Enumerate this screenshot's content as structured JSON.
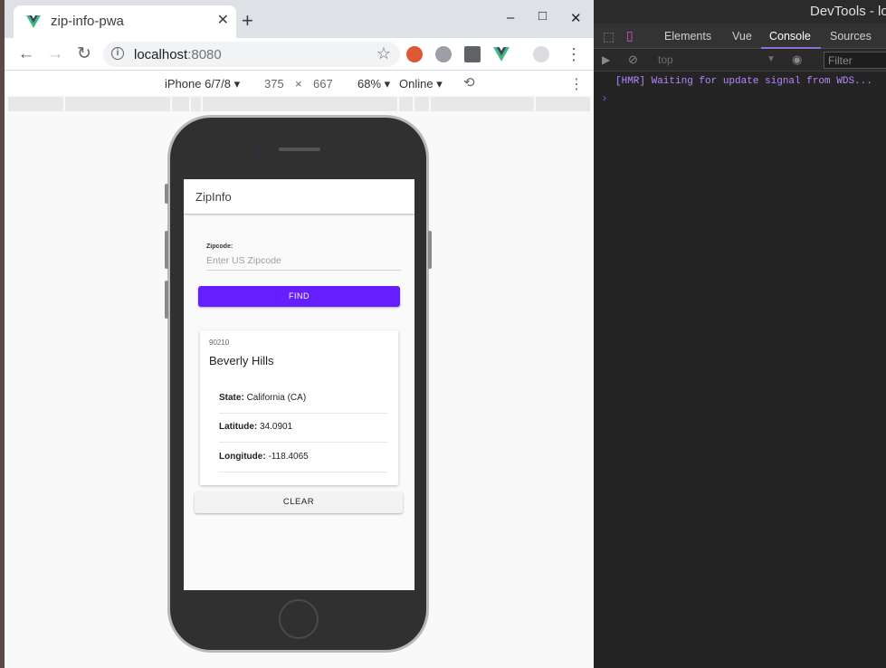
{
  "browser": {
    "tab_title": "zip-info-pwa",
    "tab_close": "✕",
    "new_tab": "+",
    "window_controls": {
      "minimize": "–",
      "maximize": "□",
      "close": "✕"
    },
    "url_host": "localhost",
    "url_port": ":8080",
    "star": "☆",
    "extensions": [
      "duckduckgo-icon",
      "ghostery-icon",
      "ublock-icon",
      "vue-devtools-icon"
    ],
    "menu": "⋮"
  },
  "device_toolbar": {
    "device": "iPhone 6/7/8",
    "width": "375",
    "times": "×",
    "height": "667",
    "zoom": "68%",
    "network": "Online",
    "rotate": "⟲",
    "menu": "⋮"
  },
  "app": {
    "title": "ZipInfo",
    "zip_label": "Zipcode:",
    "zip_placeholder": "Enter US Zipcode",
    "find_button": "FIND",
    "result": {
      "zip": "90210",
      "city": "Beverly Hills",
      "state_label": "State:",
      "state_value": "California (CA)",
      "lat_label": "Latitude:",
      "lat_value": "34.0901",
      "lon_label": "Longitude:",
      "lon_value": "-118.4065"
    },
    "clear_button": "CLEAR"
  },
  "devtools": {
    "title": "DevTools - lo",
    "tabs": [
      "Elements",
      "Vue",
      "Console",
      "Sources"
    ],
    "active_tab": "Console",
    "context": "top",
    "filter_placeholder": "Filter",
    "console_message": "[HMR] Waiting for update signal from WDS...",
    "prompt": "›"
  },
  "colors": {
    "accent": "#651fff",
    "vue_green": "#41b883",
    "console_purple": "#b388ff"
  }
}
